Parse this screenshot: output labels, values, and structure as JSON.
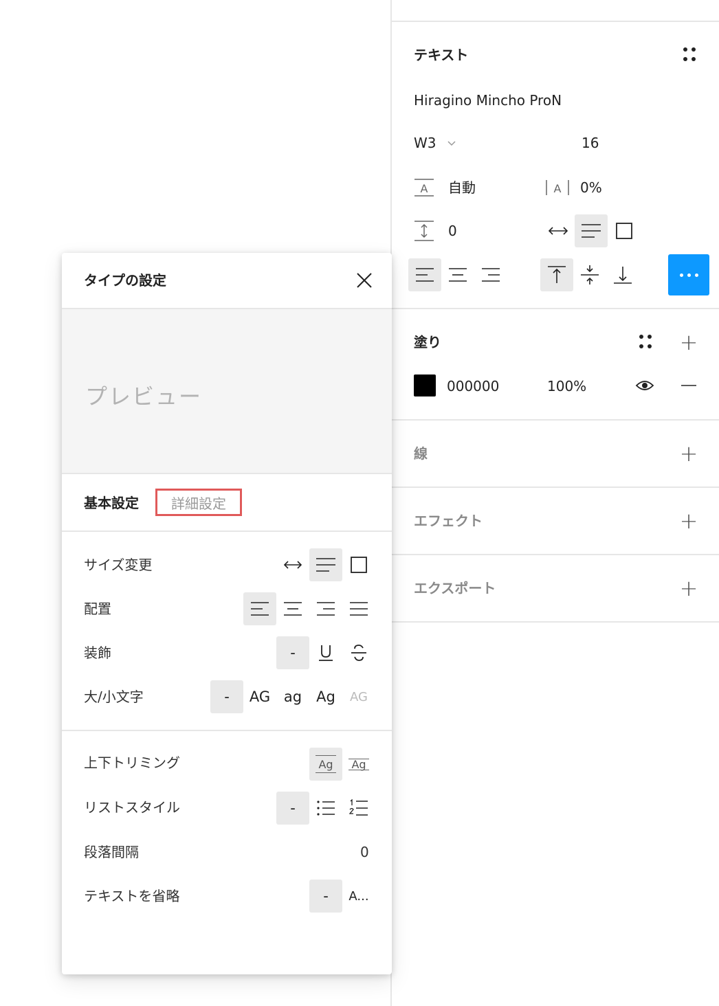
{
  "text_section": {
    "title": "テキスト",
    "font_family": "Hiragino Mincho ProN",
    "font_weight": "W3",
    "font_size": "16",
    "line_height": "自動",
    "letter_spacing": "0%",
    "paragraph_spacing": "0"
  },
  "fill_section": {
    "title": "塗り",
    "color_hex": "000000",
    "opacity": "100%",
    "swatch_color": "#000000"
  },
  "stroke_section": {
    "title": "線"
  },
  "effects_section": {
    "title": "エフェクト"
  },
  "export_section": {
    "title": "エクスポート"
  },
  "type_settings_dialog": {
    "title": "タイプの設定",
    "preview_text": "プレビュー",
    "tabs": {
      "basic": "基本設定",
      "advanced": "詳細設定"
    },
    "rows": {
      "resize": "サイズ変更",
      "alignment": "配置",
      "decoration": "装飾",
      "case": "大/小文字",
      "vertical_trim": "上下トリミング",
      "list_style": "リストスタイル",
      "paragraph_spacing": "段落間隔",
      "truncate": "テキストを省略"
    },
    "none_label": "-",
    "case_options": {
      "upper": "AG",
      "lower": "ag",
      "title": "Ag",
      "small_caps": "AG"
    },
    "trim_labels": {
      "standard": "Ag",
      "cap": "Ag"
    },
    "paragraph_spacing_value": "0",
    "truncate_option": "A..."
  },
  "colors": {
    "accent": "#0d99ff",
    "highlight_border": "#e05a5a",
    "selected_bg": "#e9e9e9"
  }
}
